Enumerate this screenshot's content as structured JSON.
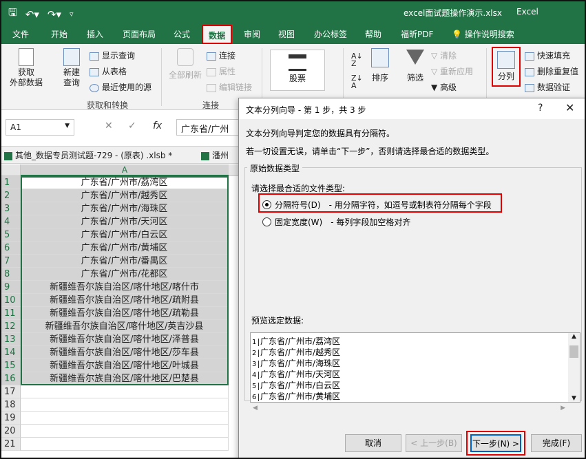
{
  "window": {
    "title": "excel面试题操作演示.xlsx",
    "app": "Excel",
    "qat_icons": [
      "save-icon",
      "undo-icon",
      "redo-icon",
      "customize-icon"
    ]
  },
  "tabs": [
    "文件",
    "开始",
    "插入",
    "页面布局",
    "公式",
    "数据",
    "审阅",
    "视图",
    "办公标签",
    "帮助",
    "福昕PDF",
    "操作说明搜索"
  ],
  "active_tab": "数据",
  "ribbon": {
    "get_external": "获取\n外部数据",
    "new_query": "新建\n查询",
    "show_query": "显示查询",
    "from_table": "从表格",
    "recent_sources": "最近使用的源",
    "group1": "获取和转换",
    "refresh_all": "全部刷新",
    "connections": "连接",
    "properties": "属性",
    "edit_links": "编辑链接",
    "group2": "连接",
    "stocks": "股票",
    "sort": "排序",
    "filter": "筛选",
    "clear": "清除",
    "reapply": "重新应用",
    "advanced": "高级",
    "text_to_columns": "分列",
    "flash_fill": "快速填充",
    "remove_duplicates": "删除重复值",
    "data_validation": "数据验证"
  },
  "formula_bar": {
    "namebox": "A1",
    "fx": "fx",
    "value": "广东省/广州"
  },
  "workbook_tabs": [
    "其他_数据专员测试题-729 -  (原表) .xlsb *",
    "潘州"
  ],
  "grid": {
    "column": "A",
    "rows": [
      {
        "n": "1",
        "v": "广东省/广州市/荔湾区"
      },
      {
        "n": "2",
        "v": "广东省/广州市/越秀区"
      },
      {
        "n": "3",
        "v": "广东省/广州市/海珠区"
      },
      {
        "n": "4",
        "v": "广东省/广州市/天河区"
      },
      {
        "n": "5",
        "v": "广东省/广州市/白云区"
      },
      {
        "n": "6",
        "v": "广东省/广州市/黄埔区"
      },
      {
        "n": "7",
        "v": "广东省/广州市/番禺区"
      },
      {
        "n": "8",
        "v": "广东省/广州市/花都区"
      },
      {
        "n": "9",
        "v": "新疆维吾尔族自治区/喀什地区/喀什市"
      },
      {
        "n": "10",
        "v": "新疆维吾尔族自治区/喀什地区/疏附县"
      },
      {
        "n": "11",
        "v": "新疆维吾尔族自治区/喀什地区/疏勒县"
      },
      {
        "n": "12",
        "v": "新疆维吾尔族自治区/喀什地区/英吉沙县"
      },
      {
        "n": "13",
        "v": "新疆维吾尔族自治区/喀什地区/泽普县"
      },
      {
        "n": "14",
        "v": "新疆维吾尔族自治区/喀什地区/莎车县"
      },
      {
        "n": "15",
        "v": "新疆维吾尔族自治区/喀什地区/叶城县"
      },
      {
        "n": "16",
        "v": "新疆维吾尔族自治区/喀什地区/巴楚县"
      },
      {
        "n": "17",
        "v": ""
      },
      {
        "n": "18",
        "v": ""
      },
      {
        "n": "19",
        "v": ""
      },
      {
        "n": "20",
        "v": ""
      },
      {
        "n": "21",
        "v": ""
      }
    ]
  },
  "dialog": {
    "title": "文本分列向导 - 第 1 步，共 3 步",
    "help": "?",
    "close": "✕",
    "line1": "文本分列向导判定您的数据具有分隔符。",
    "line2": "若一切设置无误，请单击“下一步”，否则请选择最合适的数据类型。",
    "group_legend": "原始数据类型",
    "choose_label": "请选择最合适的文件类型:",
    "opt1_label": "分隔符号(D)",
    "opt1_desc": "- 用分隔字符，如逗号或制表符分隔每个字段",
    "opt2_label": "固定宽度(W)",
    "opt2_desc": "- 每列字段加空格对齐",
    "preview_label": "预览选定数据:",
    "preview_rows": [
      {
        "n": "1",
        "v": "广东省/广州市/荔湾区"
      },
      {
        "n": "2",
        "v": "广东省/广州市/越秀区"
      },
      {
        "n": "3",
        "v": "广东省/广州市/海珠区"
      },
      {
        "n": "4",
        "v": "广东省/广州市/天河区"
      },
      {
        "n": "5",
        "v": "广东省/广州市/白云区"
      },
      {
        "n": "6",
        "v": "广东省/广州市/黄埔区"
      }
    ],
    "btn_cancel": "取消",
    "btn_back": "< 上一步(B)",
    "btn_next": "下一步(N) >",
    "btn_finish": "完成(F)"
  }
}
